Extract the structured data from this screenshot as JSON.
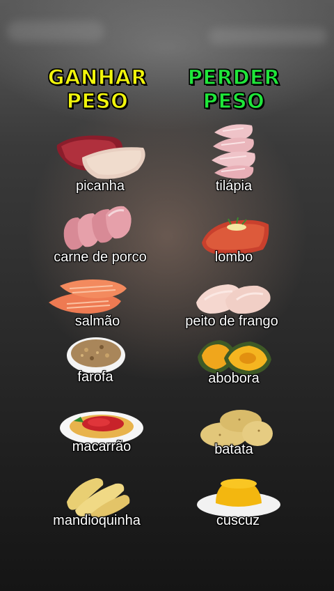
{
  "headings": {
    "left": {
      "line1": "GANHAR",
      "line2": "PESO",
      "color": "#f1f50c"
    },
    "right": {
      "line1": "PERDER",
      "line2": "PESO",
      "color": "#1fe63a"
    }
  },
  "left_items": [
    {
      "label": "picanha",
      "icon": "picanha-icon"
    },
    {
      "label": "carne de porco",
      "icon": "pork-icon"
    },
    {
      "label": "salmão",
      "icon": "salmon-icon"
    },
    {
      "label": "farofa",
      "icon": "farofa-icon"
    },
    {
      "label": "macarrão",
      "icon": "pasta-icon"
    },
    {
      "label": "mandioquinha",
      "icon": "mandioquinha-icon"
    }
  ],
  "right_items": [
    {
      "label": "tilápia",
      "icon": "tilapia-icon"
    },
    {
      "label": "lombo",
      "icon": "lombo-icon"
    },
    {
      "label": "peito de frango",
      "icon": "chicken-breast-icon"
    },
    {
      "label": "abobora",
      "icon": "pumpkin-icon"
    },
    {
      "label": "batata",
      "icon": "potato-icon"
    },
    {
      "label": "cuscuz",
      "icon": "cuscuz-icon"
    }
  ]
}
